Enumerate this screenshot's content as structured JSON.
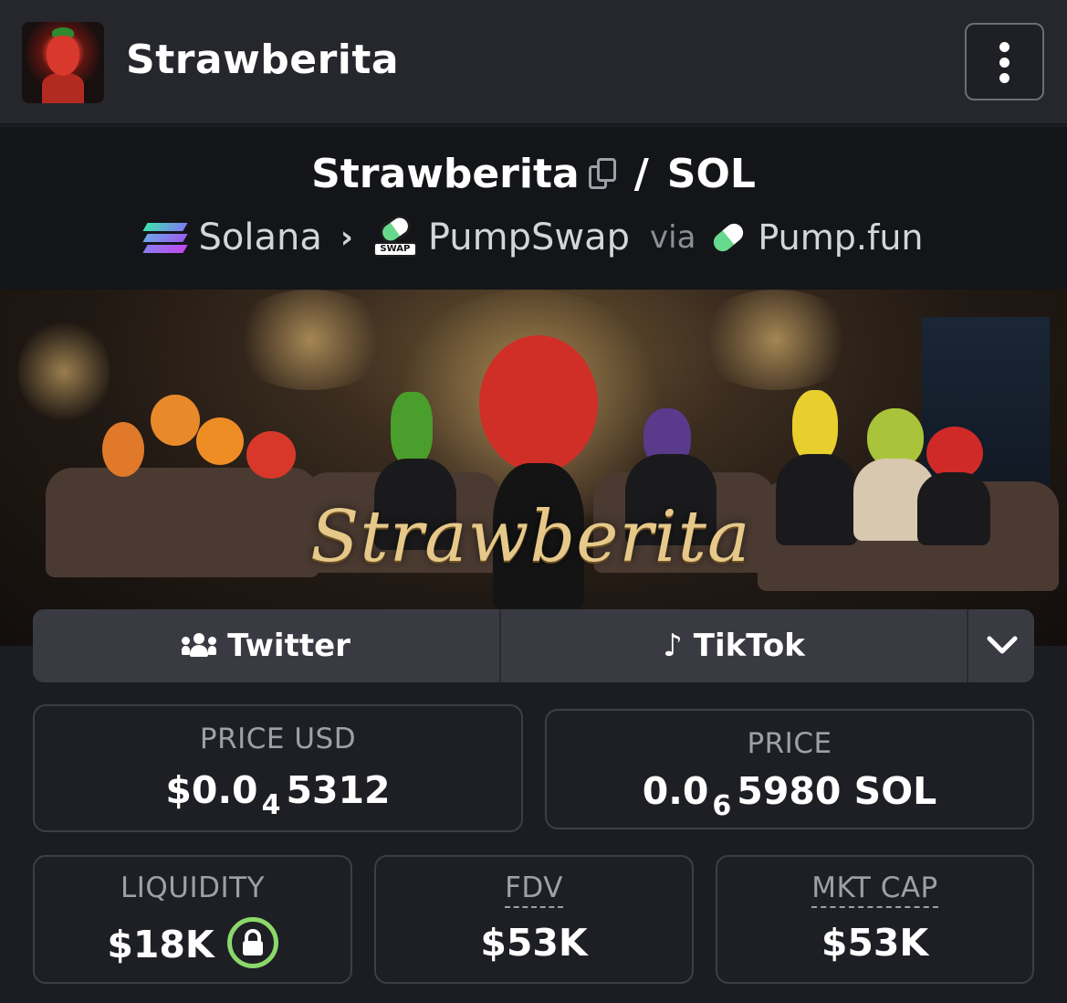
{
  "header": {
    "title": "Strawberita",
    "avatar_icon": "strawberry-avatar-icon",
    "menu_icon": "more-vertical-icon"
  },
  "pair": {
    "base": "Strawberita",
    "separator": "/",
    "quote": "SOL",
    "copy_icon": "copy-icon"
  },
  "route": {
    "chain": "Solana",
    "dex": "PumpSwap",
    "dex_icon_tag": "SWAP",
    "via": "via",
    "launchpad": "Pump.fun"
  },
  "banner": {
    "logo_text": "Strawberita"
  },
  "socials": {
    "twitter_label": "Twitter",
    "tiktok_label": "TikTok",
    "twitter_icon": "users-icon",
    "tiktok_icon": "tiktok-icon",
    "more_icon": "chevron-down-icon"
  },
  "stats": {
    "price_usd": {
      "label": "PRICE USD",
      "prefix": "$0.0",
      "zeros": "4",
      "digits": "5312"
    },
    "price_native": {
      "label": "PRICE",
      "prefix": "0.0",
      "zeros": "6",
      "digits": "5980 SOL"
    },
    "liquidity": {
      "label": "LIQUIDITY",
      "value": "$18K",
      "lock_icon": "lock-icon"
    },
    "fdv": {
      "label": "FDV",
      "value": "$53K"
    },
    "mkt_cap": {
      "label": "MKT CAP",
      "value": "$53K"
    }
  },
  "colors": {
    "background": "#1c1d22",
    "lock_ring": "#8bd86a",
    "pill_green": "#67d98c"
  }
}
